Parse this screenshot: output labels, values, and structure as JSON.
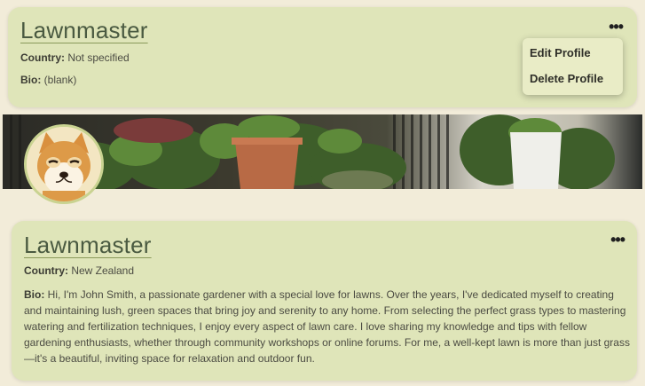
{
  "profile_summary": {
    "name": "Lawnmaster",
    "country_label": "Country:",
    "country_value": "Not specified",
    "bio_label": "Bio:",
    "bio_value": "(blank)",
    "more_icon": "•••"
  },
  "menu": {
    "items": [
      {
        "label": "Edit Profile"
      },
      {
        "label": "Delete Profile"
      }
    ]
  },
  "profile_detail": {
    "name": "Lawnmaster",
    "country_label": "Country:",
    "country_value": "New Zealand",
    "bio_label": "Bio:",
    "bio_value": "Hi, I'm John Smith, a passionate gardener with a special love for lawns. Over the years, I've dedicated myself to creating and maintaining lush, green spaces that bring joy and serenity to any home. From selecting the perfect grass types to mastering watering and fertilization techniques, I enjoy every aspect of lawn care. I love sharing my knowledge and tips with fellow gardening enthusiasts, whether through community workshops or online forums. For me, a well-kept lawn is more than just grass—it's a beautiful, inviting space for relaxation and outdoor fun.",
    "more_icon": "•••"
  },
  "colors": {
    "page_bg": "#f2ecd9",
    "card_bg": "#dfe5b9",
    "menu_bg": "#e9ecc6",
    "name_color": "#4a5a41"
  },
  "icons": {
    "banner": "plants-photo",
    "avatar": "shiba-dog-photo"
  }
}
